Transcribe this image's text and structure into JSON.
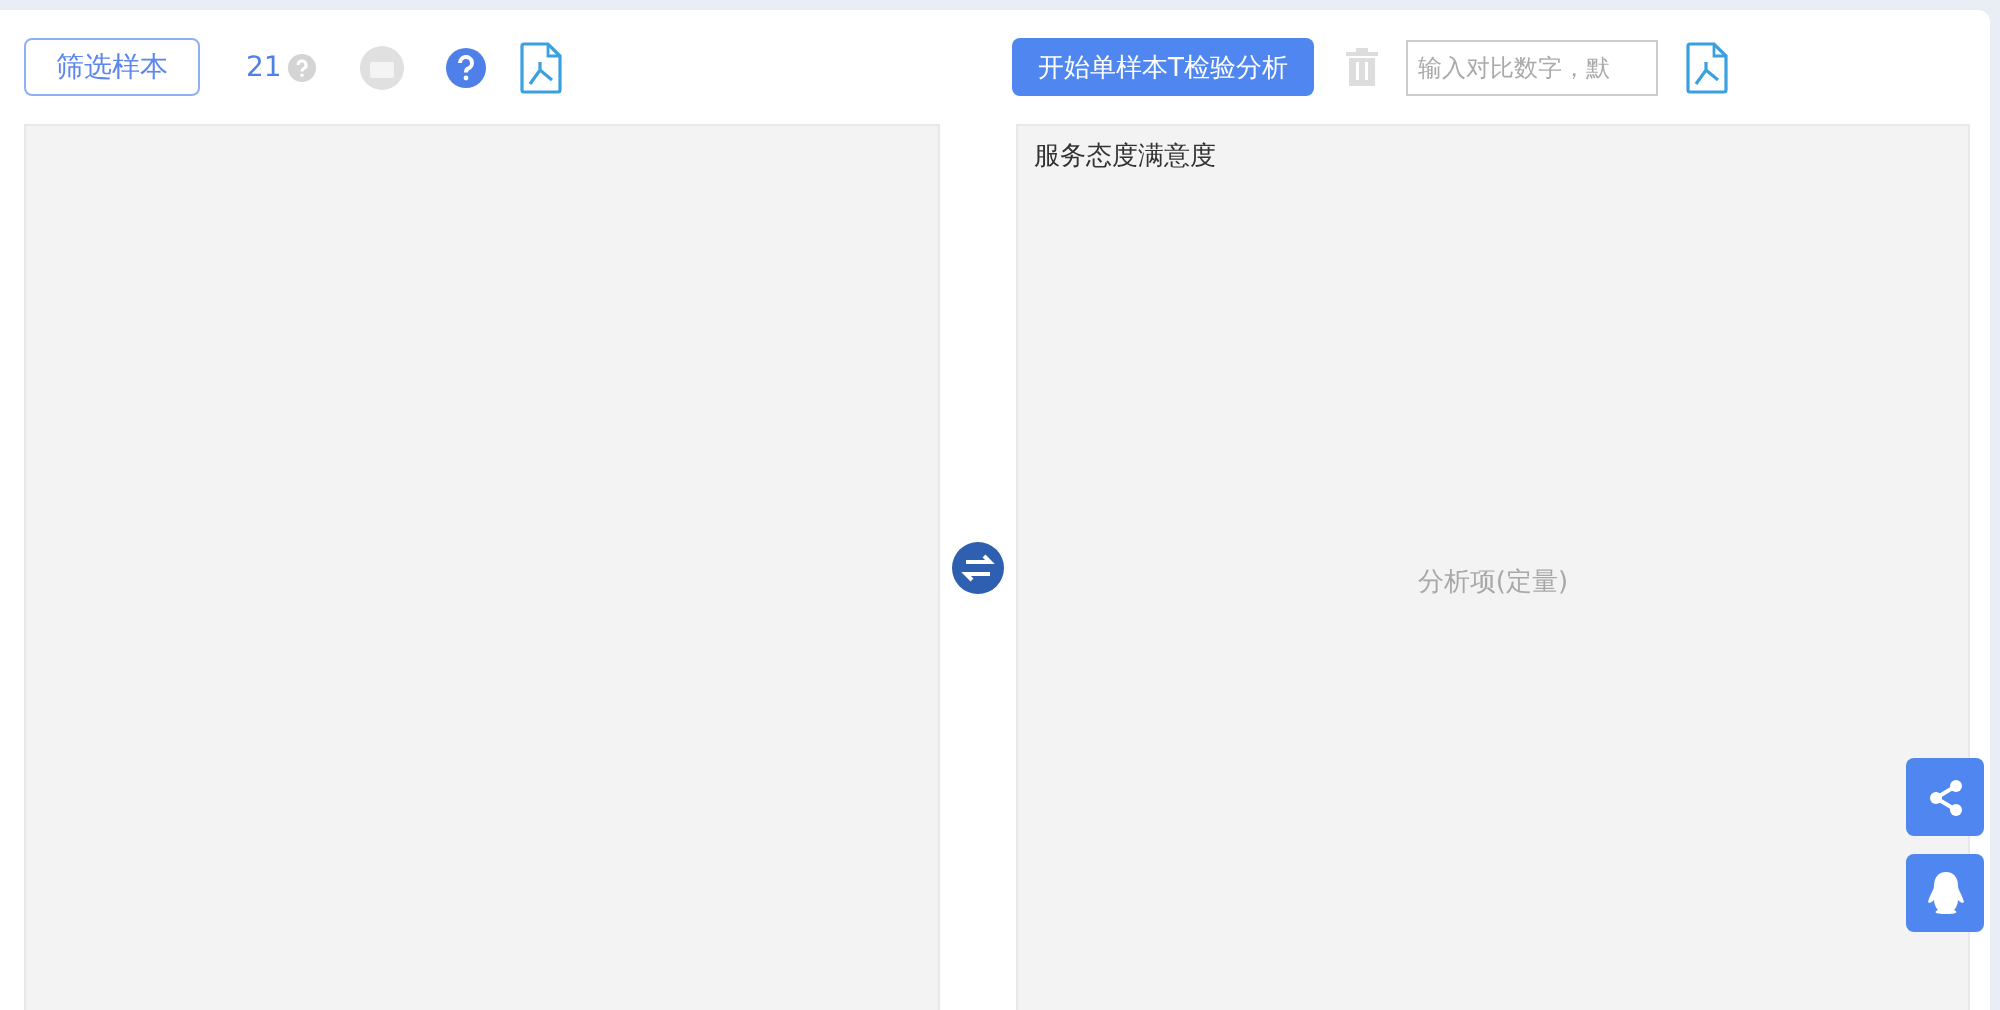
{
  "left_toolbar": {
    "filter_button": "筛选样本",
    "sample_count": "21"
  },
  "right_toolbar": {
    "start_button": "开始单样本T检验分析",
    "compare_input": {
      "placeholder": "输入对比数字，默"
    }
  },
  "right_panel": {
    "items": [
      "服务态度满意度"
    ],
    "placeholder": "分析项(定量)"
  }
}
